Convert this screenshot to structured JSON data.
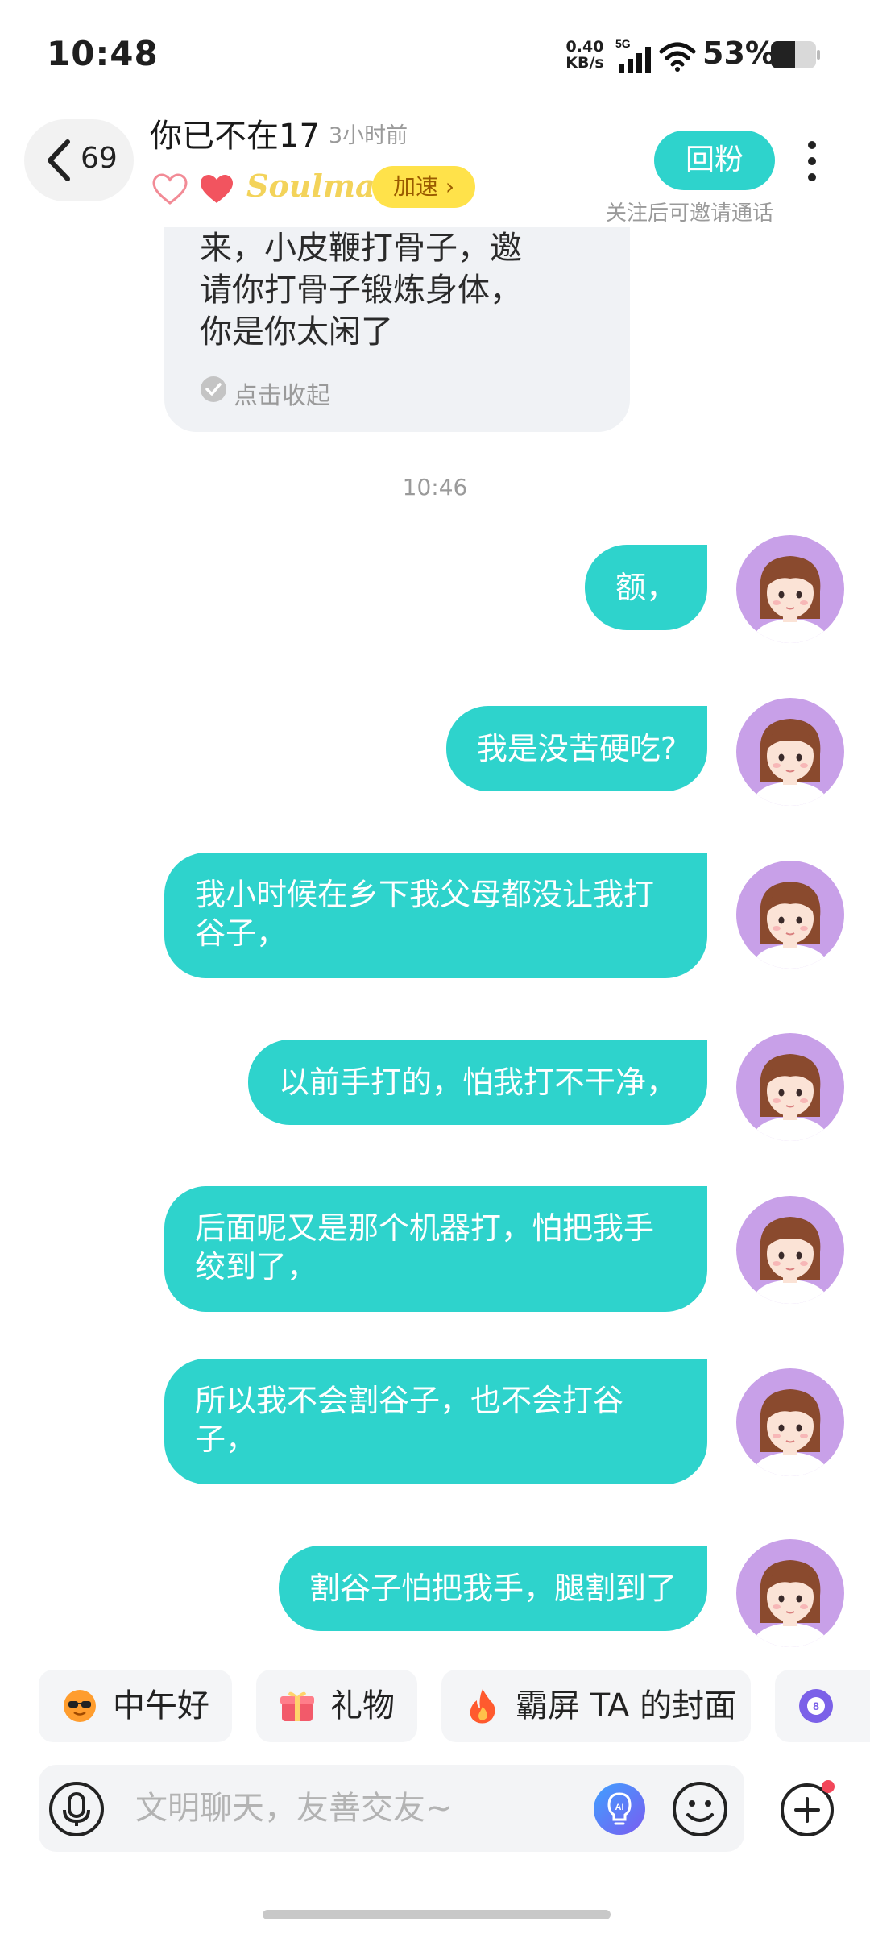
{
  "status_bar": {
    "time": "10:48",
    "net_speed_value": "0.40",
    "net_speed_unit": "KB/s",
    "network_type": "5G",
    "battery_percent": "53%"
  },
  "header": {
    "back_count": "69",
    "peer_name": "你已不在17",
    "last_seen": "3小时前",
    "soulmate_label": "Soulmate",
    "speedup_label": "加速 ›",
    "follow_back_label": "回粉",
    "call_hint": "关注后可邀请通话"
  },
  "incoming_message": {
    "text": "来，小皮鞭打骨子，邀\n请你打骨子锻炼身体，\n你是你太闲了",
    "collapse_label": "点击收起"
  },
  "timestamp": "10:46",
  "outgoing_messages": [
    "额，",
    "我是没苦硬吃?",
    "我小时候在乡下我父母都没让我打谷子，",
    "以前手打的，怕我打不干净，",
    "后面呢又是那个机器打，怕把我手绞到了，",
    "所以我不会割谷子，也不会打谷子，",
    "割谷子怕把我手，腿割到了"
  ],
  "quick_replies": [
    {
      "label": "中午好",
      "icon": "sun-sunglasses-icon"
    },
    {
      "label": "礼物",
      "icon": "gift-icon"
    },
    {
      "label": "霸屏 TA 的封面",
      "icon": "fire-icon"
    },
    {
      "label": "8",
      "icon": "eight-ball-icon"
    }
  ],
  "input": {
    "placeholder": "文明聊天，友善交友~"
  },
  "colors": {
    "accent": "#2ed3cc",
    "avatar_bg": "#c8a0e8",
    "badge": "#ffe24a"
  }
}
